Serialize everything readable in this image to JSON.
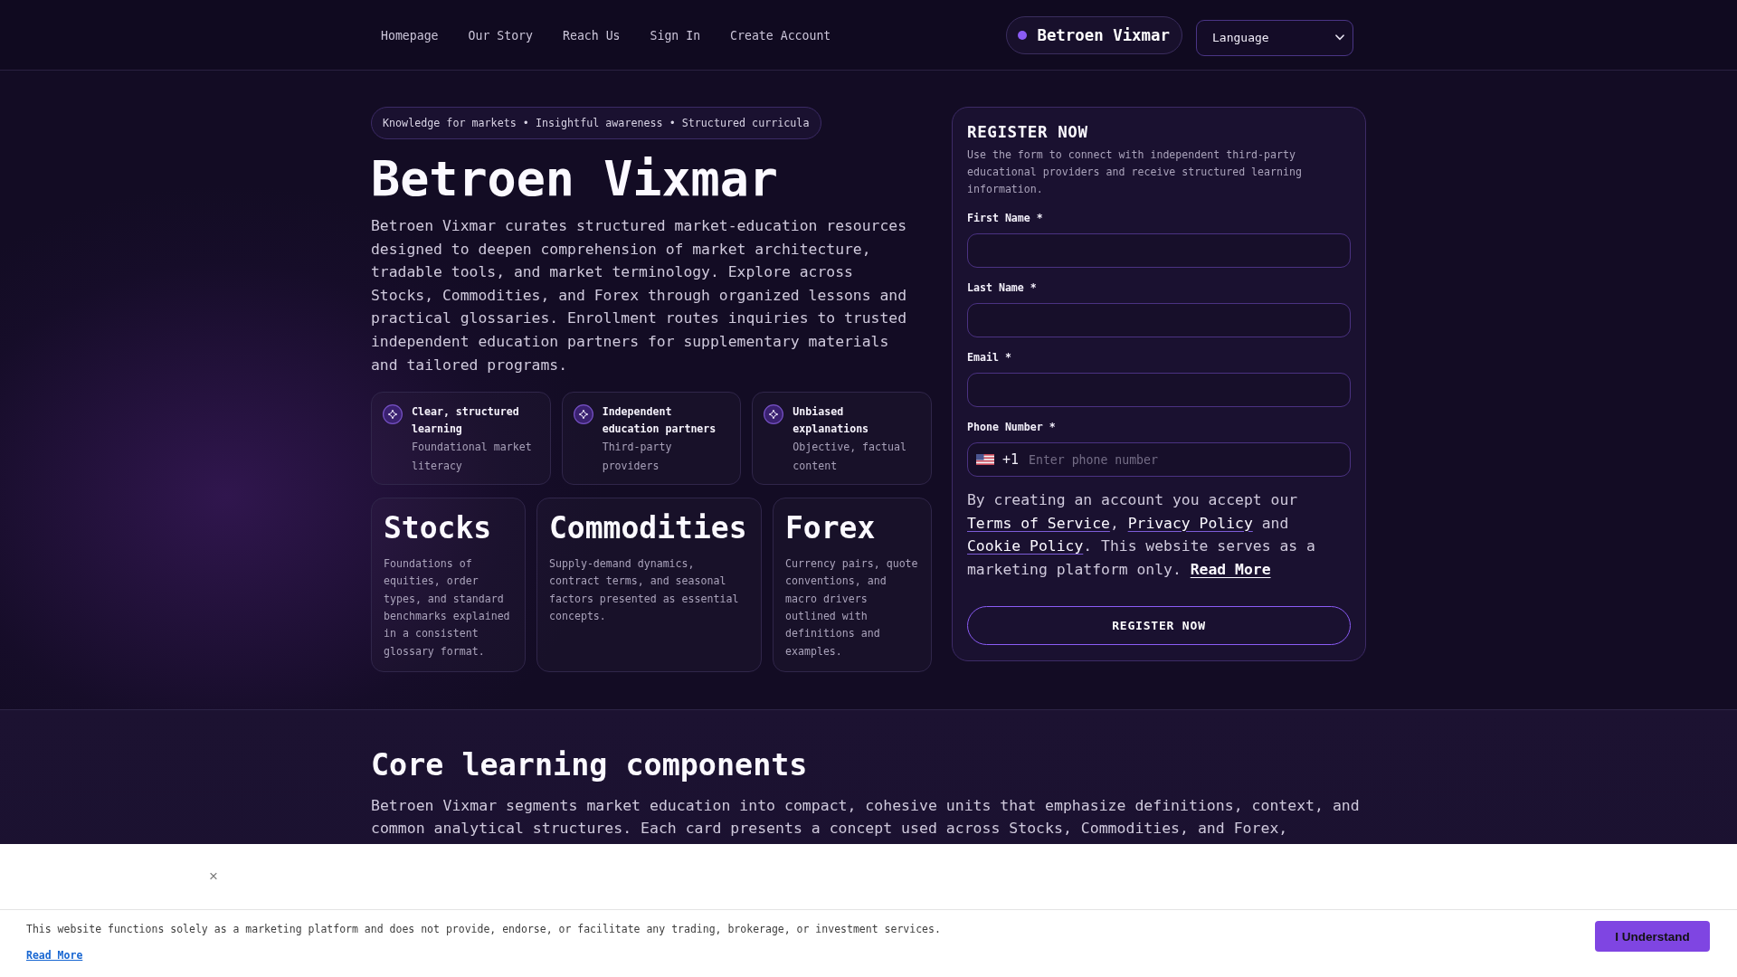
{
  "nav": {
    "links": [
      {
        "label": "Homepage"
      },
      {
        "label": "Our Story"
      },
      {
        "label": "Reach Us"
      },
      {
        "label": "Sign In"
      },
      {
        "label": "Create Account"
      }
    ],
    "brand": "Betroen Vixmar",
    "language_select": {
      "value": "Language"
    }
  },
  "hero": {
    "tagline": "Knowledge for markets • Insightful awareness • Structured curricula",
    "title": "Betroen Vixmar",
    "description": "Betroen Vixmar curates structured market-education resources designed to deepen comprehension of market architecture, tradable tools, and market terminology. Explore across Stocks, Commodities, and Forex through organized lessons and practical glossaries. Enrollment routes inquiries to trusted independent education partners for supplementary materials and tailored programs.",
    "features": [
      {
        "title": "Clear, structured learning",
        "subtitle": "Foundational market literacy"
      },
      {
        "title": "Independent education partners",
        "subtitle": "Third-party providers"
      },
      {
        "title": "Unbiased explanations",
        "subtitle": "Objective, factual content"
      }
    ],
    "topics": [
      {
        "title": "Stocks",
        "description": "Foundations of equities, order types, and standard benchmarks explained in a consistent glossary format."
      },
      {
        "title": "Commodities",
        "description": "Supply-demand dynamics, contract terms, and seasonal factors presented as essential concepts."
      },
      {
        "title": "Forex",
        "description": "Currency pairs, quote conventions, and macro drivers outlined with definitions and examples."
      }
    ]
  },
  "register_form": {
    "title": "REGISTER NOW",
    "description": "Use the form to connect with independent third-party educational providers and receive structured learning information.",
    "fields": [
      {
        "kind": "text",
        "label": "First Name *"
      },
      {
        "kind": "text",
        "label": "Last Name *"
      },
      {
        "kind": "email",
        "label": "Email *"
      },
      {
        "kind": "phone",
        "label": "Phone Number *",
        "country_code": "+1",
        "placeholder": "Enter phone number"
      }
    ],
    "consent": [
      {
        "kind": "text",
        "text": "By creating an account you accept our "
      },
      {
        "kind": "link",
        "text": "Terms of Service"
      },
      {
        "kind": "text",
        "text": ", "
      },
      {
        "kind": "link",
        "text": "Privacy Policy"
      },
      {
        "kind": "text",
        "text": " and "
      },
      {
        "kind": "link",
        "text": "Cookie Policy"
      },
      {
        "kind": "text",
        "text": ". This website serves as a marketing platform only. "
      },
      {
        "kind": "strong_link",
        "text": "Read More"
      }
    ],
    "submit": "REGISTER NOW"
  },
  "core_section": {
    "title": "Core learning components",
    "description": "Betroen Vixmar segments market education into compact, cohesive units that emphasize definitions, context, and common analytical structures. Each card presents a concept used across Stocks, Commodities, and Forex,"
  },
  "cookie_banner": {
    "close": "×",
    "message": "This website functions solely as a marketing platform and does not provide, endorse, or facilitate any trading, brokerage, or investment services.",
    "link": "Read More",
    "button": "I Understand"
  }
}
